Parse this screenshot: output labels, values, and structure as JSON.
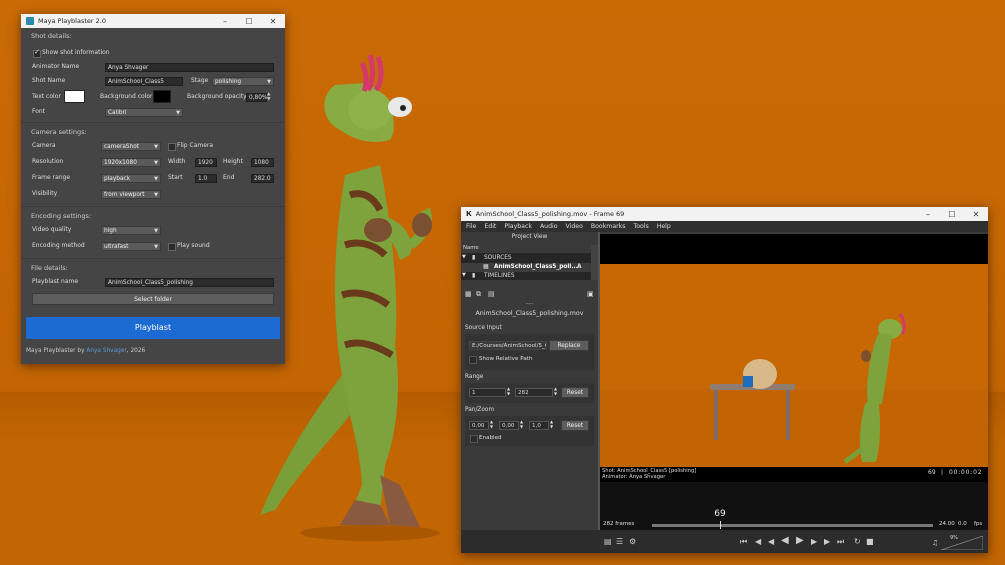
{
  "playblaster": {
    "title": "Maya Playblaster 2.0",
    "shot_details": {
      "heading": "Shot details:",
      "show_shot_info_label": "Show shot information",
      "animator_label": "Animator Name",
      "animator_value": "Anya Shvager",
      "shot_label": "Shot Name",
      "shot_value": "AnimSchool_Class5",
      "stage_label": "Stage",
      "stage_value": "polishing",
      "text_color_label": "Text color",
      "text_color": "#ffffff",
      "bg_color_label": "Background color",
      "bg_color": "#000000",
      "bg_opacity_label": "Background opacity",
      "bg_opacity_value": "0,80%",
      "font_label": "Font",
      "font_value": "Calibri"
    },
    "camera_settings": {
      "heading": "Camera settings:",
      "camera_label": "Camera",
      "camera_value": "cameraShot",
      "flip_label": "Flip Camera",
      "resolution_label": "Resolution",
      "resolution_value": "1920x1080",
      "width_label": "Width",
      "width_value": "1920",
      "height_label": "Height",
      "height_value": "1080",
      "frame_range_label": "Frame range",
      "frame_range_value": "playback",
      "start_label": "Start",
      "start_value": "1.0",
      "end_label": "End",
      "end_value": "282.0",
      "visibility_label": "Visibility",
      "visibility_value": "from viewport"
    },
    "encoding_settings": {
      "heading": "Encoding settings:",
      "quality_label": "Video quality",
      "quality_value": "high",
      "method_label": "Encoding method",
      "method_value": "ultrafast",
      "play_sound_label": "Play sound"
    },
    "file_details": {
      "heading": "File details:",
      "name_label": "Playblast name",
      "name_value": "AnimSchool_Class5_polishing",
      "select_folder_label": "Select folder"
    },
    "playblast_button": "Playblast",
    "footer_prefix": "Maya Playblaster by ",
    "footer_author": "Anya Shvager",
    "footer_suffix": ", 2026"
  },
  "rv": {
    "title": "AnimSchool_Class5_polishing.mov - Frame 69",
    "menu": [
      "File",
      "Edit",
      "Playback",
      "Audio",
      "Video",
      "Bookmarks",
      "Tools",
      "Help"
    ],
    "project_view_label": "Project View",
    "column_name": "Name",
    "tree_sources": "SOURCES",
    "tree_source_item": "AnimSchool_Class5_poli...",
    "tree_source_flag": "A",
    "tree_timelines": "TIMELINES",
    "media_title": "AnimSchool_Class5_polishing.mov",
    "source_input_label": "Source Input",
    "source_path": "E:/Courses/AnimSchool/5_C",
    "replace_label": "Replace",
    "show_relative_label": "Show Relative Path",
    "range_label": "Range",
    "range_start": "1",
    "range_end": "282",
    "reset_label": "Reset",
    "panzoom_label": "Pan/Zoom",
    "pan_x": "0,00",
    "pan_y": "0,00",
    "zoom": "1,0",
    "enabled_label": "Enabled",
    "hud_shot": "Shot: AnimSchool_Class5 [polishing]",
    "hud_animator": "Animator: Anya Shvager",
    "hud_frame": "69",
    "hud_sep": "|",
    "hud_timecode": "00:00:02",
    "current_frame": "69",
    "frame_count": "282 frames",
    "fps_value": "24.00",
    "fps_extra": "0.0",
    "fps_label": "fps",
    "volume": "9%",
    "playhead_fraction": 0.241
  }
}
